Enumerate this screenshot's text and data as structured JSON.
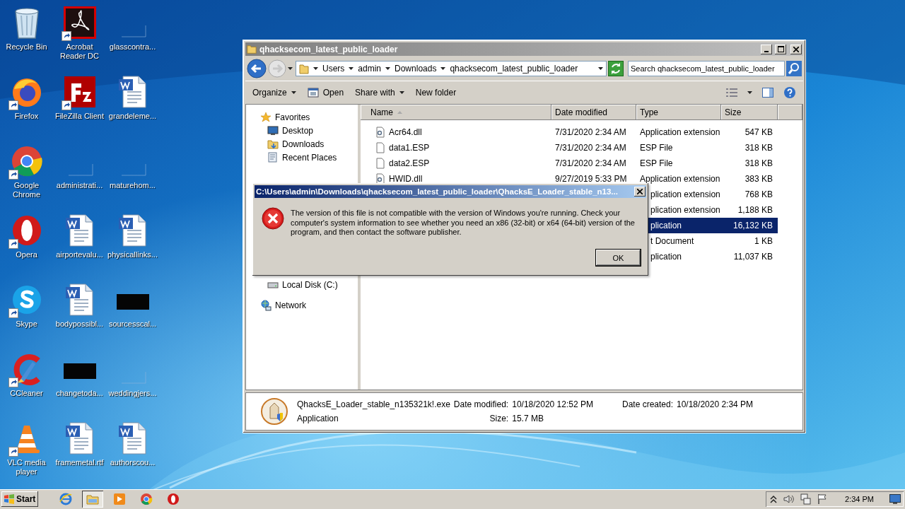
{
  "desktop_icons": [
    {
      "label": "Recycle Bin",
      "kind": "recycle",
      "shortcut": false
    },
    {
      "label": "Acrobat Reader DC",
      "kind": "acrobat",
      "shortcut": true
    },
    {
      "label": "glasscontra...",
      "kind": "blank",
      "shortcut": false
    },
    {
      "label": "Firefox",
      "kind": "firefox",
      "shortcut": true
    },
    {
      "label": "FileZilla Client",
      "kind": "filezilla",
      "shortcut": true
    },
    {
      "label": "grandeleme...",
      "kind": "word",
      "shortcut": false
    },
    {
      "label": "Google Chrome",
      "kind": "chrome",
      "shortcut": true
    },
    {
      "label": "administrati...",
      "kind": "blank",
      "shortcut": false
    },
    {
      "label": "maturehom...",
      "kind": "blank",
      "shortcut": false
    },
    {
      "label": "Opera",
      "kind": "opera",
      "shortcut": true
    },
    {
      "label": "airportevalu...",
      "kind": "word",
      "shortcut": false
    },
    {
      "label": "physicallinks...",
      "kind": "word",
      "shortcut": false
    },
    {
      "label": "Skype",
      "kind": "skype",
      "shortcut": true
    },
    {
      "label": "bodypossibl...",
      "kind": "word",
      "shortcut": false
    },
    {
      "label": "sourcesscal...",
      "kind": "black",
      "shortcut": false
    },
    {
      "label": "CCleaner",
      "kind": "ccleaner",
      "shortcut": true
    },
    {
      "label": "changetoda...",
      "kind": "black",
      "shortcut": false
    },
    {
      "label": "weddingjers...",
      "kind": "blank",
      "shortcut": false
    },
    {
      "label": "VLC media player",
      "kind": "vlc",
      "shortcut": true
    },
    {
      "label": "framemetal.rtf",
      "kind": "word",
      "shortcut": false
    },
    {
      "label": "authorscou...",
      "kind": "word",
      "shortcut": false
    }
  ],
  "explorer": {
    "title": "qhacksecom_latest_public_loader",
    "breadcrumb": [
      "Users",
      "admin",
      "Downloads",
      "qhacksecom_latest_public_loader"
    ],
    "search": {
      "placeholder": "Search qhacksecom_latest_public_loader"
    },
    "toolbar": [
      {
        "label": "Organize",
        "kind": "menu"
      },
      {
        "label": "Open",
        "kind": "open"
      },
      {
        "label": "Share with",
        "kind": "menu"
      },
      {
        "label": "New folder",
        "kind": "plain"
      }
    ],
    "nav": [
      {
        "label": "Favorites",
        "children": [
          {
            "label": "Desktop"
          },
          {
            "label": "Downloads"
          },
          {
            "label": "Recent Places"
          }
        ]
      },
      {
        "children": [
          {
            "label": "Local Disk (C:)"
          }
        ]
      },
      {
        "label": "Network"
      }
    ],
    "columns": [
      {
        "label": "Name",
        "sorted": true
      },
      {
        "label": "Date modified",
        "sorted": false
      },
      {
        "label": "Type",
        "sorted": false
      },
      {
        "label": "Size",
        "sorted": false
      }
    ],
    "rows": [
      {
        "name": "Acr64.dll",
        "date": "7/31/2020 2:34 AM",
        "type": "Application extension",
        "size": "547 KB",
        "selected": false
      },
      {
        "name": "data1.ESP",
        "date": "7/31/2020 2:34 AM",
        "type": "ESP File",
        "size": "318 KB",
        "selected": false
      },
      {
        "name": "data2.ESP",
        "date": "7/31/2020 2:34 AM",
        "type": "ESP File",
        "size": "318 KB",
        "selected": false
      },
      {
        "name": "HWID.dll",
        "date": "9/27/2019 5:33 PM",
        "type": "Application extension",
        "size": "383 KB",
        "selected": false
      },
      {
        "type": "plication extension",
        "size": "768 KB",
        "selected": false
      },
      {
        "type": "plication extension",
        "size": "1,188 KB",
        "selected": false
      },
      {
        "type": "plication",
        "size": "16,132 KB",
        "selected": true
      },
      {
        "type": "t Document",
        "size": "1 KB",
        "selected": false
      },
      {
        "type": "plication",
        "size": "11,037 KB",
        "selected": false
      }
    ],
    "details": {
      "name": "QhacksE_Loader_stable_n135321k!.exe",
      "type": "Application",
      "modified": {
        "label": "Date modified:",
        "value": "10/18/2020 12:52 PM"
      },
      "size": {
        "label": "Size:",
        "value": "15.7 MB"
      },
      "created": {
        "label": "Date created:",
        "value": "10/18/2020 2:34 PM"
      }
    }
  },
  "dialog": {
    "title": "C:\\Users\\admin\\Downloads\\qhacksecom_latest_public_loader\\QhacksE_Loader_stable_n13...",
    "message": "The version of this file is not compatible with the version of Windows you're running. Check your computer's system information to see whether you need an x86 (32-bit) or x64 (64-bit) version of the program, and then contact the software publisher.",
    "buttons": [
      {
        "label": "OK",
        "default": true
      }
    ]
  },
  "taskbar": {
    "start": "Start",
    "apps": [
      {
        "kind": "ie",
        "active": false
      },
      {
        "kind": "explorer",
        "active": true
      },
      {
        "kind": "media",
        "active": false
      },
      {
        "kind": "chrome",
        "active": false
      },
      {
        "kind": "opera",
        "active": false
      }
    ],
    "clock": "2:34 PM"
  }
}
